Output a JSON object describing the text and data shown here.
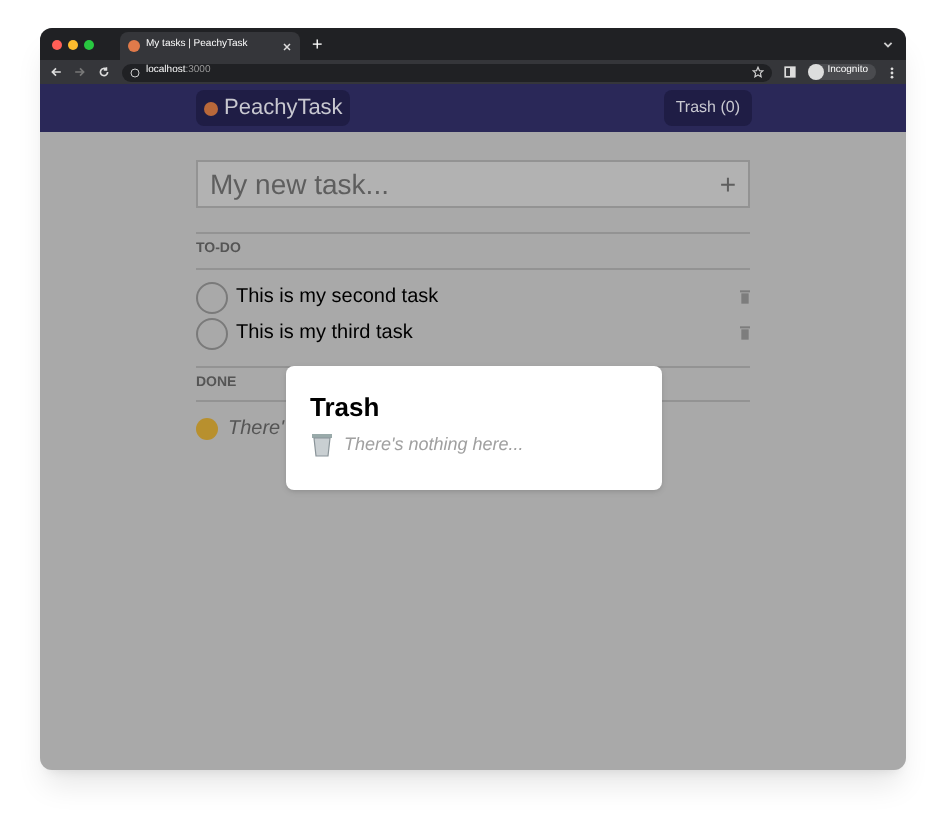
{
  "browser": {
    "tab_title": "My tasks | PeachyTask",
    "new_tab": "+",
    "url_host": "localhost",
    "url_port": ":3000",
    "profile": "Incognito"
  },
  "nav": {
    "brand": "PeachyTask",
    "trash_button": "Trash (0)"
  },
  "new_task": {
    "placeholder": "My new task...",
    "add": "+"
  },
  "todo": {
    "heading": "TO-DO",
    "tasks": [
      {
        "text": "This is my second task",
        "checked": false
      },
      {
        "text": "This is my third task",
        "checked": false
      }
    ]
  },
  "done": {
    "heading": "DONE",
    "empty_text": "There'"
  },
  "modal": {
    "title": "Trash",
    "empty_text": "There's nothing here..."
  }
}
